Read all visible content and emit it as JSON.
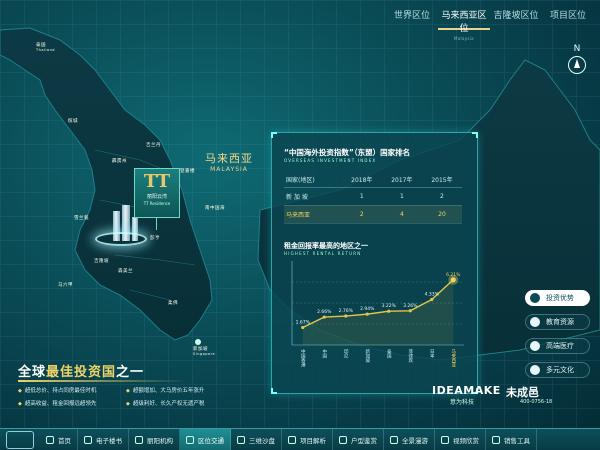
{
  "top_tabs": [
    {
      "label": "世界区位",
      "sub": "",
      "active": false
    },
    {
      "label": "马来西亚区位",
      "sub": "Malaysia",
      "active": true
    },
    {
      "label": "吉隆坡区位",
      "sub": "",
      "active": false
    },
    {
      "label": "项目区位",
      "sub": "",
      "active": false
    }
  ],
  "compass": {
    "label": "N"
  },
  "map": {
    "country_cn": "马来西亚",
    "country_en": "MALAYSIA",
    "places": {
      "thailand": "泰国",
      "thailand_en": "Thailand",
      "penang": "槟城",
      "kelantan": "吉兰丹",
      "terengganu": "登嘉楼",
      "perak": "霹雳州",
      "pahang": "彭亨",
      "selangor": "雪兰莪",
      "kuala_lumpur": "吉隆坡",
      "negeri": "森美兰",
      "melaka": "马六甲",
      "johor": "柔佛",
      "singapore": "新加坡",
      "singapore_en": "Singapore",
      "south_china_sea": "南中国海"
    }
  },
  "project_card": {
    "logo": "TT",
    "name": "丽阳云湾",
    "sub": "TT Residence"
  },
  "panel": {
    "title": "“中国海外投资指数”（东盟）国家排名",
    "subtitle": "OVERSEAS INVESTMENT INDEX",
    "table": {
      "headers": [
        "国家(地区)",
        "2018年",
        "2017年",
        "2015年"
      ],
      "rows": [
        {
          "cells": [
            "新 加 坡",
            "1",
            "1",
            "2"
          ],
          "highlight": false
        },
        {
          "cells": [
            "马来西亚",
            "2",
            "4",
            "20"
          ],
          "highlight": true
        }
      ]
    },
    "chart_title": "租金回报率最高的地区之一",
    "chart_subtitle": "HIGHEST RENTAL RETURN"
  },
  "chart_data": {
    "type": "line",
    "categories": [
      "中国香港",
      "中国",
      "印尼",
      "新加坡",
      "泰国",
      "菲律宾",
      "日本",
      "马来西亚"
    ],
    "values": [
      1.67,
      2.66,
      2.76,
      2.94,
      3.22,
      3.26,
      4.33,
      6.21
    ],
    "value_labels": [
      "1.67%",
      "2.66%",
      "2.76%",
      "2.94%",
      "3.22%",
      "3.26%",
      "4.33%",
      "6.21%"
    ],
    "ylim": [
      0,
      8
    ],
    "highlight_index": 7,
    "colors": {
      "line": "#e3c549",
      "highlight": "#f2d45c",
      "point": "#e3c549"
    }
  },
  "side_menu": [
    {
      "label": "投资优势",
      "active": true
    },
    {
      "label": "教育资源",
      "active": false
    },
    {
      "label": "高端医疗",
      "active": false
    },
    {
      "label": "多元文化",
      "active": false
    }
  ],
  "headline": {
    "pre": "全球",
    "highlight": "最佳投资国",
    "post": "之一"
  },
  "bullets": [
    "超低总价、持占同房最佳时机",
    "超额增加、大马房价五年涨升",
    "超高收益、租金回报远超领先",
    "超级利好、长久产权无遗产税"
  ],
  "brand": {
    "name": "IDEAMAKE",
    "cn": "意为科技",
    "name2": "未成邑",
    "tel": "400-0756-18"
  },
  "bottom_nav": [
    {
      "label": "首页",
      "active": false
    },
    {
      "label": "电子楼书",
      "active": false
    },
    {
      "label": "丽阳机构",
      "active": false
    },
    {
      "label": "区位交通",
      "active": true
    },
    {
      "label": "三维沙盘",
      "active": false
    },
    {
      "label": "项目解析",
      "active": false
    },
    {
      "label": "户型鉴赏",
      "active": false
    },
    {
      "label": "全景漫游",
      "active": false
    },
    {
      "label": "视频欣赏",
      "active": false
    },
    {
      "label": "销售工具",
      "active": false
    }
  ],
  "colors": {
    "accent": "#f0d46a",
    "panel_border": "#2ea4a6",
    "bg": "#0a4e58"
  }
}
